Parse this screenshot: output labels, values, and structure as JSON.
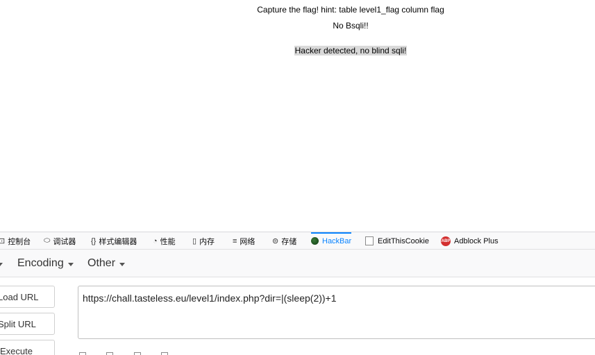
{
  "page": {
    "line1": "Capture the flag! hint: table level1_flag column flag",
    "line2": "No Bsqli!!",
    "line3": "Hacker detected, no blind sqli!"
  },
  "devtools": {
    "tabs": [
      {
        "label": "控制台",
        "icon": "console-icon"
      },
      {
        "label": "调试器",
        "icon": "debugger-icon"
      },
      {
        "label": "样式编辑器",
        "icon": "style-editor-icon"
      },
      {
        "label": "性能",
        "icon": "performance-icon"
      },
      {
        "label": "内存",
        "icon": "memory-icon"
      },
      {
        "label": "网络",
        "icon": "network-icon"
      },
      {
        "label": "存储",
        "icon": "storage-icon"
      },
      {
        "label": "HackBar",
        "icon": "hackbar-icon",
        "active": true
      },
      {
        "label": "EditThisCookie",
        "icon": "cookie-icon"
      },
      {
        "label": "Adblock Plus",
        "icon": "adblock-icon",
        "badge": "ABP"
      }
    ],
    "accent": "#0a84ff"
  },
  "hackbar": {
    "menu": {
      "encoding": "Encoding",
      "other": "Other"
    },
    "buttons": {
      "load_url": "Load URL",
      "split_url": "Split URL",
      "execute": "Execute"
    },
    "url_value": "https://chall.tasteless.eu/level1/index.php?dir=|(sleep(2))+1"
  }
}
